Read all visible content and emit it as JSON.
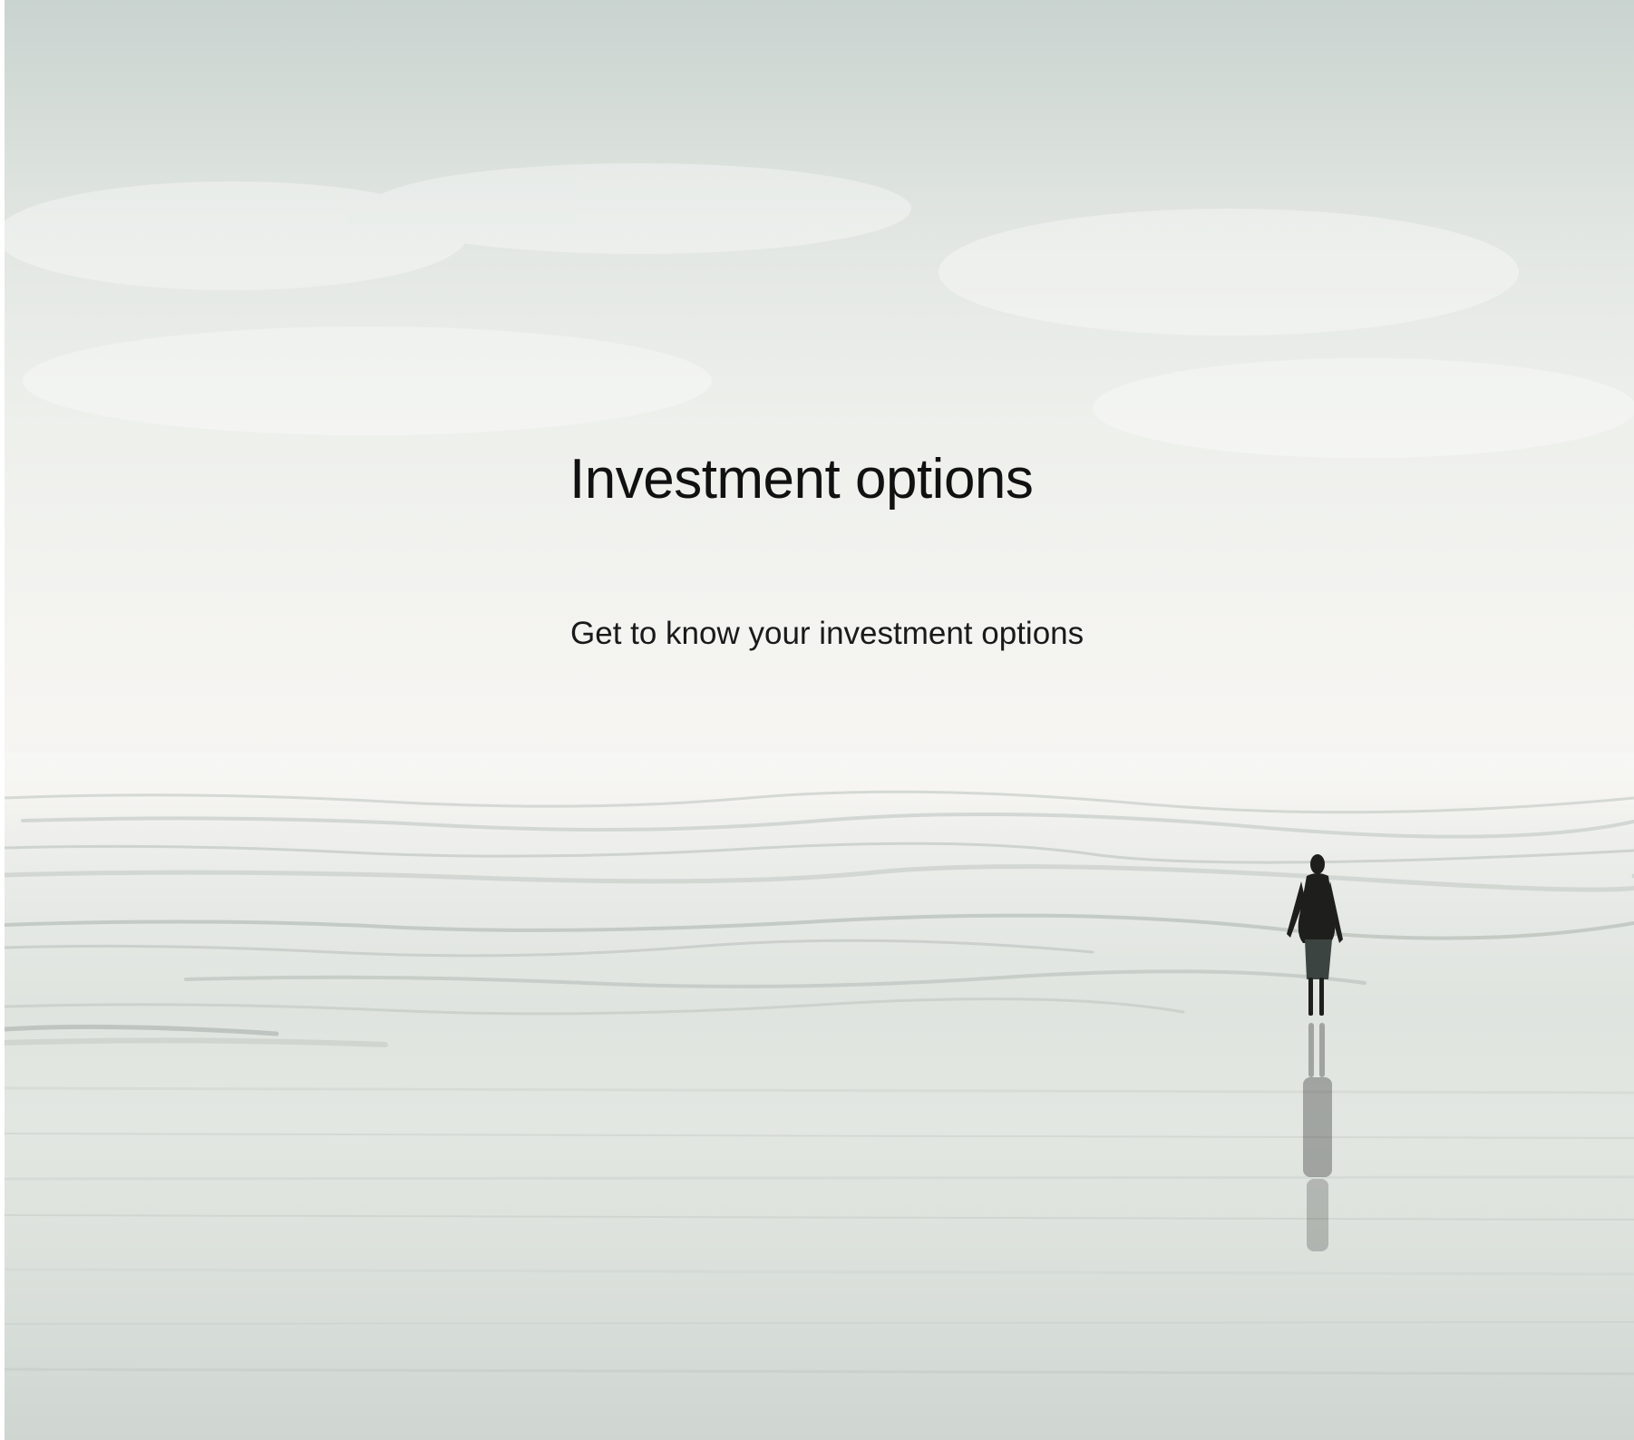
{
  "hero": {
    "title": "Investment options",
    "subtitle": "Get to know your investment options",
    "background": "misty beach with lone walker"
  },
  "colors": {
    "sky_top": "#c9d3cf",
    "sky_mid": "#f6f5f2",
    "beach": "#dde2dd",
    "text": "#111111",
    "figure": "#1e1f1d"
  }
}
